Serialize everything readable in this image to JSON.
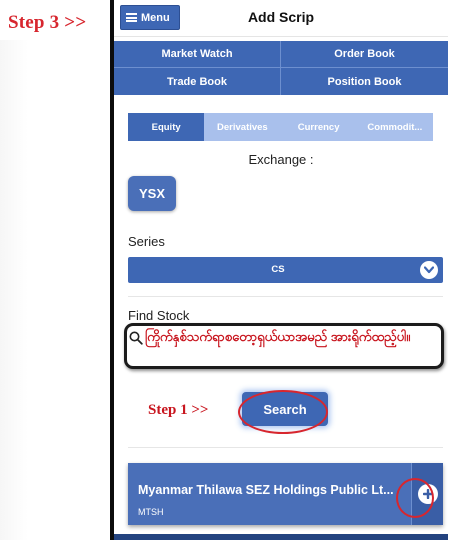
{
  "annotations": {
    "step3": "Step 3 >>",
    "step1": "Step 1 >>"
  },
  "header": {
    "menu_label": "Menu",
    "title": "Add Scrip"
  },
  "nav": {
    "items": [
      {
        "label": "Market Watch"
      },
      {
        "label": "Order Book"
      },
      {
        "label": "Trade Book"
      },
      {
        "label": "Position Book"
      }
    ]
  },
  "tabs": [
    {
      "label": "Equity",
      "active": true
    },
    {
      "label": "Derivatives",
      "active": false
    },
    {
      "label": "Currency",
      "active": false
    },
    {
      "label": "Commodit...",
      "active": false
    }
  ],
  "exchange": {
    "label": "Exchange :",
    "selected": "YSX"
  },
  "series": {
    "label": "Series",
    "selected": "CS"
  },
  "find_stock": {
    "label": "Find Stock",
    "placeholder": "ကြိုက်နှစ်သက်ရာစတော့ရှယ်ယာအမည် အားရိုက်ထည့်ပါ။",
    "search_button": "Search"
  },
  "result": {
    "name": "Myanmar Thilawa SEZ Holdings Public Lt...",
    "code": "MTSH"
  },
  "icons": {
    "menu": "hamburger-icon",
    "chevron": "chevron-down-icon",
    "search": "search-icon",
    "add": "plus-icon"
  },
  "colors": {
    "primary": "#3e67b4",
    "tab_inactive": "#a9c0ec",
    "annotation": "#d7262e"
  }
}
